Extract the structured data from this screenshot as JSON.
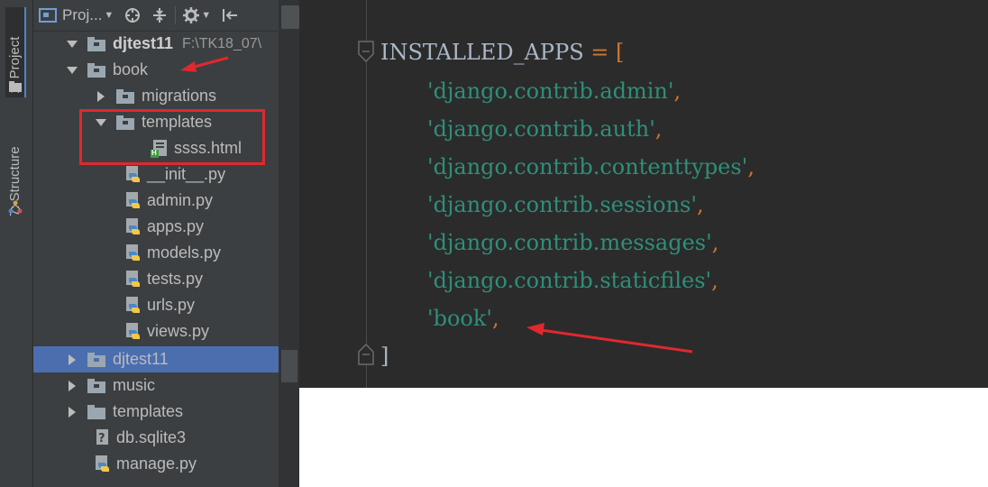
{
  "sidebar_tabs": {
    "project": "1: Project",
    "structure": "7: Structure"
  },
  "toolbar": {
    "project_label": "Proj..."
  },
  "tree": {
    "root": {
      "label": "djtest11",
      "path": "F:\\TK18_07\\"
    },
    "book": {
      "label": "book"
    },
    "migrations": {
      "label": "migrations"
    },
    "templates_inner": {
      "label": "templates"
    },
    "ssss_html": {
      "label": "ssss.html",
      "badge": "H"
    },
    "init_py": {
      "label": "__init__.py"
    },
    "admin_py": {
      "label": "admin.py"
    },
    "apps_py": {
      "label": "apps.py"
    },
    "models_py": {
      "label": "models.py"
    },
    "tests_py": {
      "label": "tests.py"
    },
    "urls_py": {
      "label": "urls.py"
    },
    "views_py": {
      "label": "views.py"
    },
    "djtest11_pkg": {
      "label": "djtest11"
    },
    "music": {
      "label": "music"
    },
    "templates_outer": {
      "label": "templates"
    },
    "db_sqlite3": {
      "label": "db.sqlite3"
    },
    "manage_py": {
      "label": "manage.py"
    }
  },
  "code": {
    "line1": {
      "ident": "INSTALLED_APPS",
      "op": " = ",
      "bracket": "["
    },
    "apps": [
      "'django.contrib.admin'",
      "'django.contrib.auth'",
      "'django.contrib.contenttypes'",
      "'django.contrib.sessions'",
      "'django.contrib.messages'",
      "'django.contrib.staticfiles'",
      "'book'"
    ],
    "comma": ",",
    "close": "]"
  },
  "colors": {
    "ide_bg": "#3c3f41",
    "editor_bg": "#2b2b2b",
    "selection": "#4b6eaf",
    "string": "#2e8f7a",
    "annotation": "#e0282e"
  }
}
